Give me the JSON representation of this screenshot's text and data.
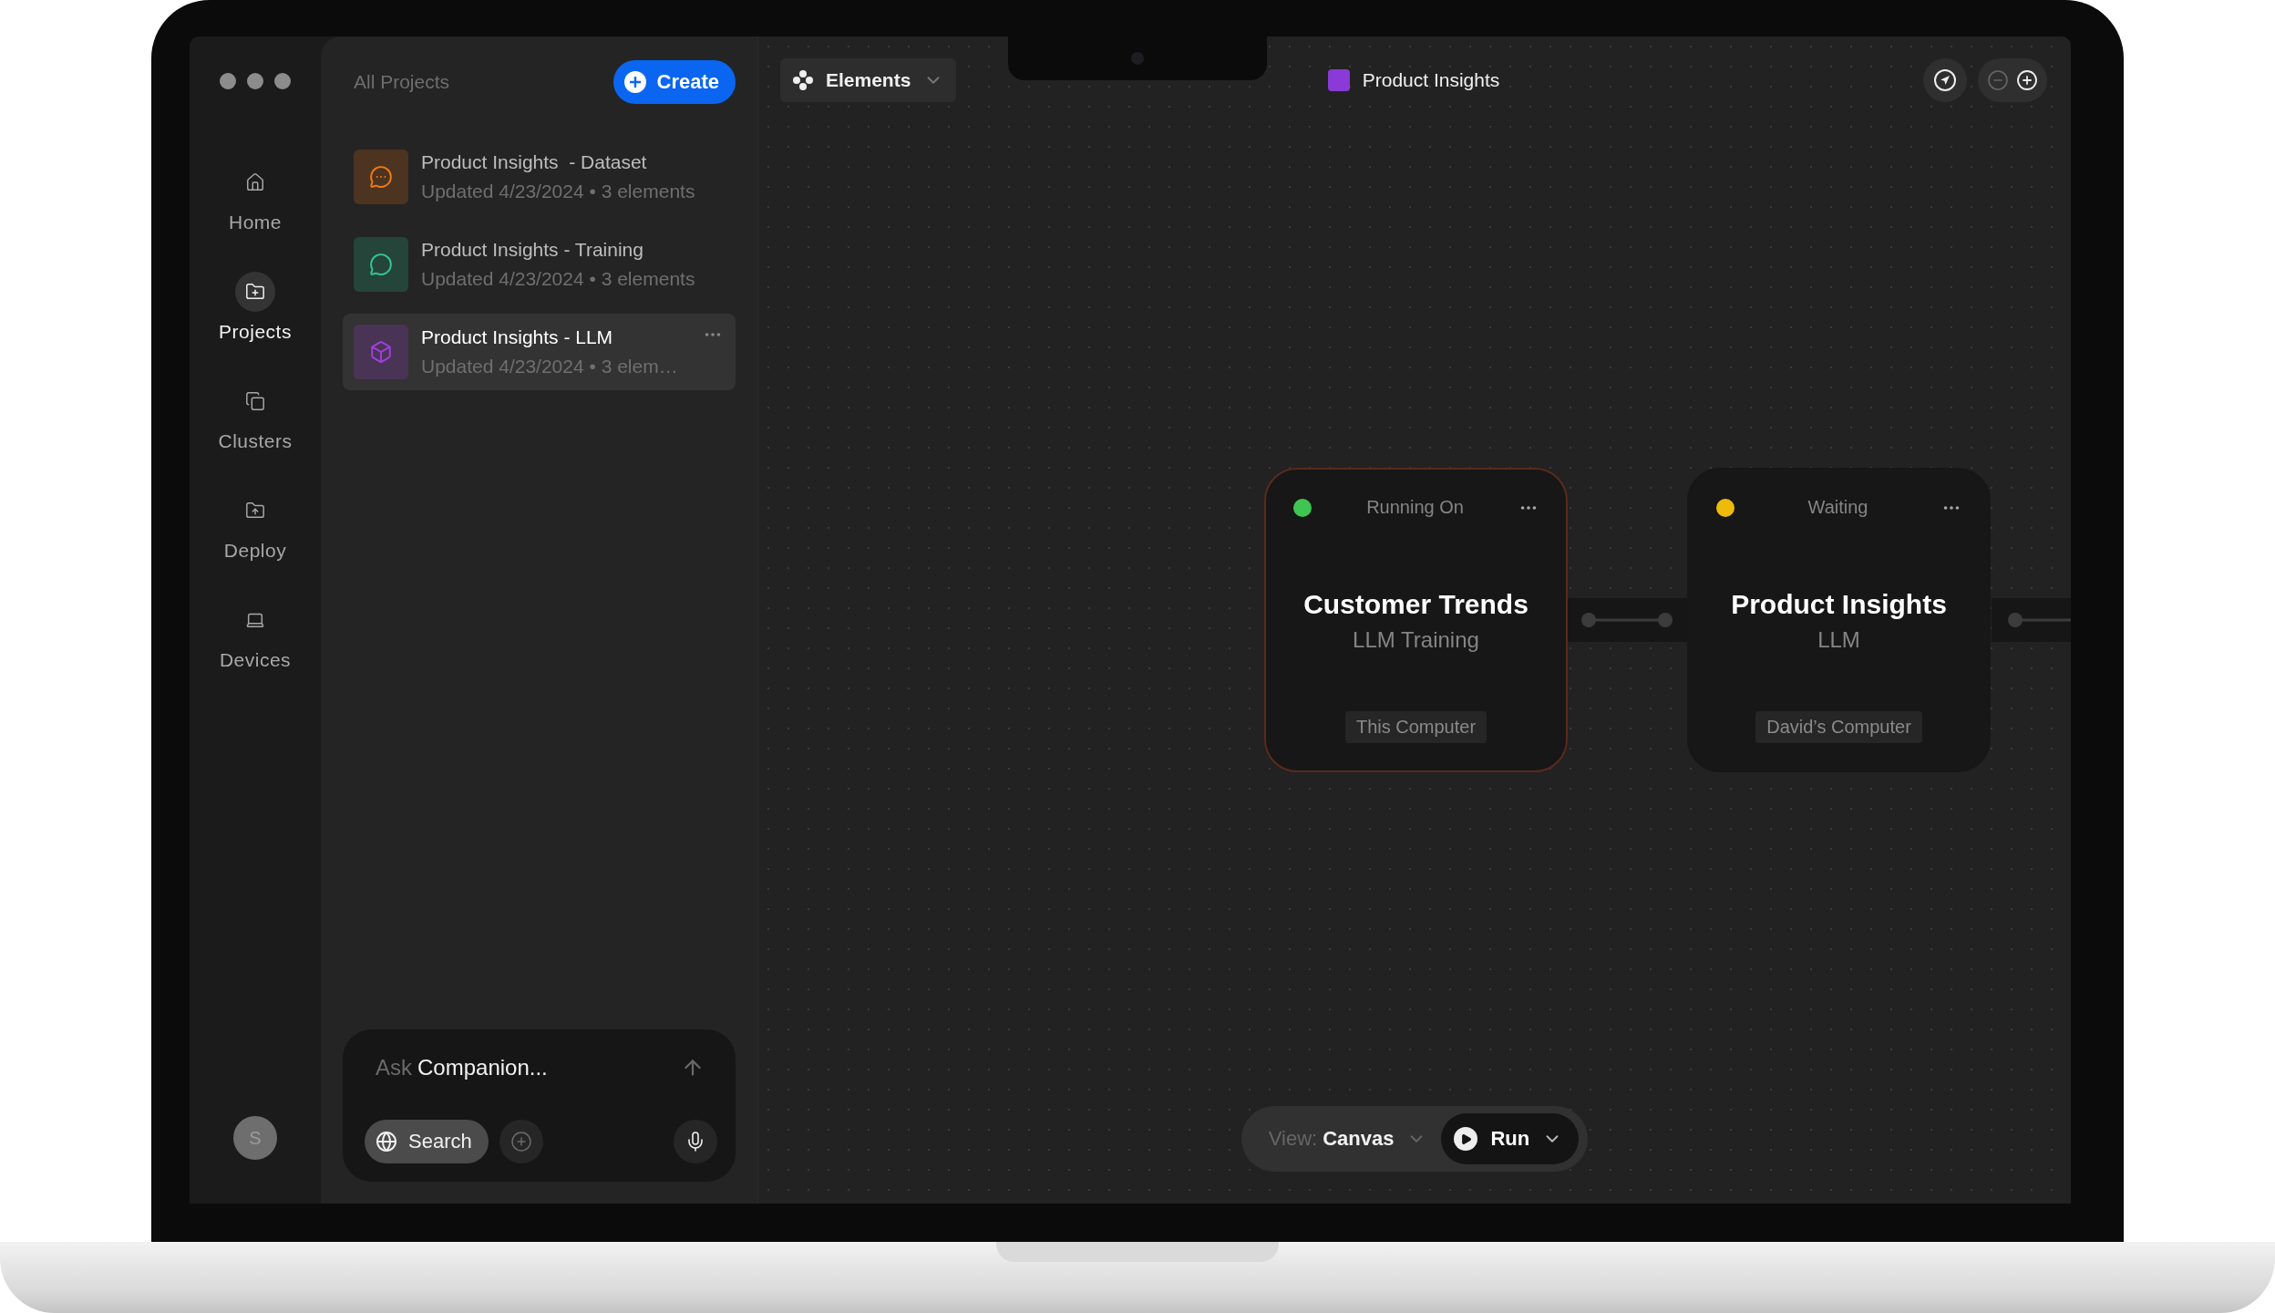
{
  "nav": [
    {
      "label": "Home",
      "selected": false
    },
    {
      "label": "Projects",
      "selected": true
    },
    {
      "label": "Clusters",
      "selected": false
    },
    {
      "label": "Deploy",
      "selected": false
    },
    {
      "label": "Devices",
      "selected": false
    }
  ],
  "avatar": "S",
  "projects": {
    "title": "All Projects",
    "create_button": "Create",
    "items": [
      {
        "title": "Product Insights  - Dataset",
        "meta": "Updated 4/23/2024 • 3 elements",
        "color": "#f07a12",
        "selected": false
      },
      {
        "title": "Product Insights - Training",
        "meta": "Updated 4/23/2024 • 3 elements",
        "color": "#2ec995",
        "selected": false
      },
      {
        "title": "Product Insights - LLM",
        "meta": "Updated 4/23/2024 • 3 elem…",
        "color": "#a33ee0",
        "selected": true
      }
    ]
  },
  "companion": {
    "ask_label": "Ask",
    "ask_text": "Companion...",
    "search_button": "Search"
  },
  "toolbar": {
    "elements_dropdown": "Elements",
    "project_title": "Product Insights"
  },
  "nodes": [
    {
      "status": "Running On",
      "color": "#3fc552",
      "title": "Customer Trends",
      "subtitle": "LLM Training",
      "device": "This Computer",
      "selected": true
    },
    {
      "status": "Waiting",
      "color": "#eebb0b",
      "title": "Product Insights",
      "subtitle": "LLM",
      "device": "David’s Computer",
      "selected": false
    }
  ],
  "bottom_bar": {
    "view_label": "View:",
    "view_value": "Canvas",
    "run_button": "Run"
  }
}
